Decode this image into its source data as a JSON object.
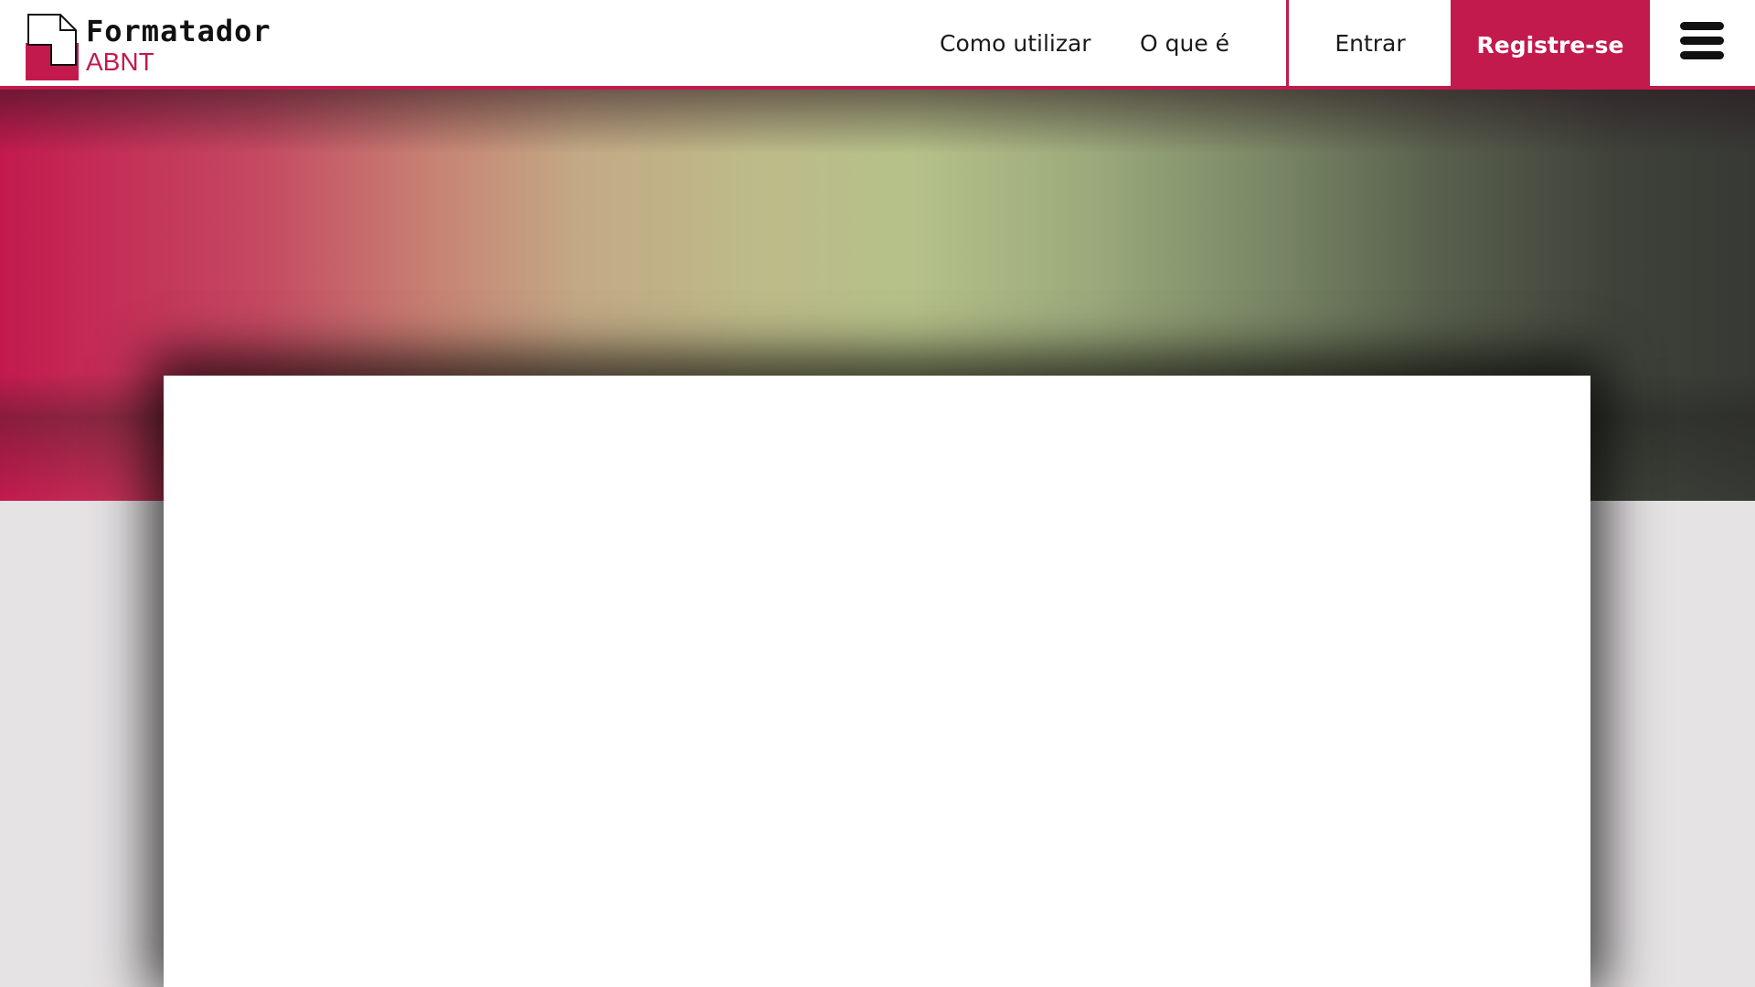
{
  "header": {
    "logo": {
      "title": "Formatador",
      "subtitle": "ABNT"
    },
    "nav": {
      "como_utilizar": "Como utilizar",
      "o_que_e": "O que é"
    },
    "entrar_label": "Entrar",
    "registre_label": "Registre-se",
    "menu_icon": "hamburger-menu-icon"
  },
  "colors": {
    "brand": "#c31a4e",
    "header_bg": "#ffffff",
    "page_bg": "#e6e3e5",
    "text": "#1a1a1a"
  }
}
